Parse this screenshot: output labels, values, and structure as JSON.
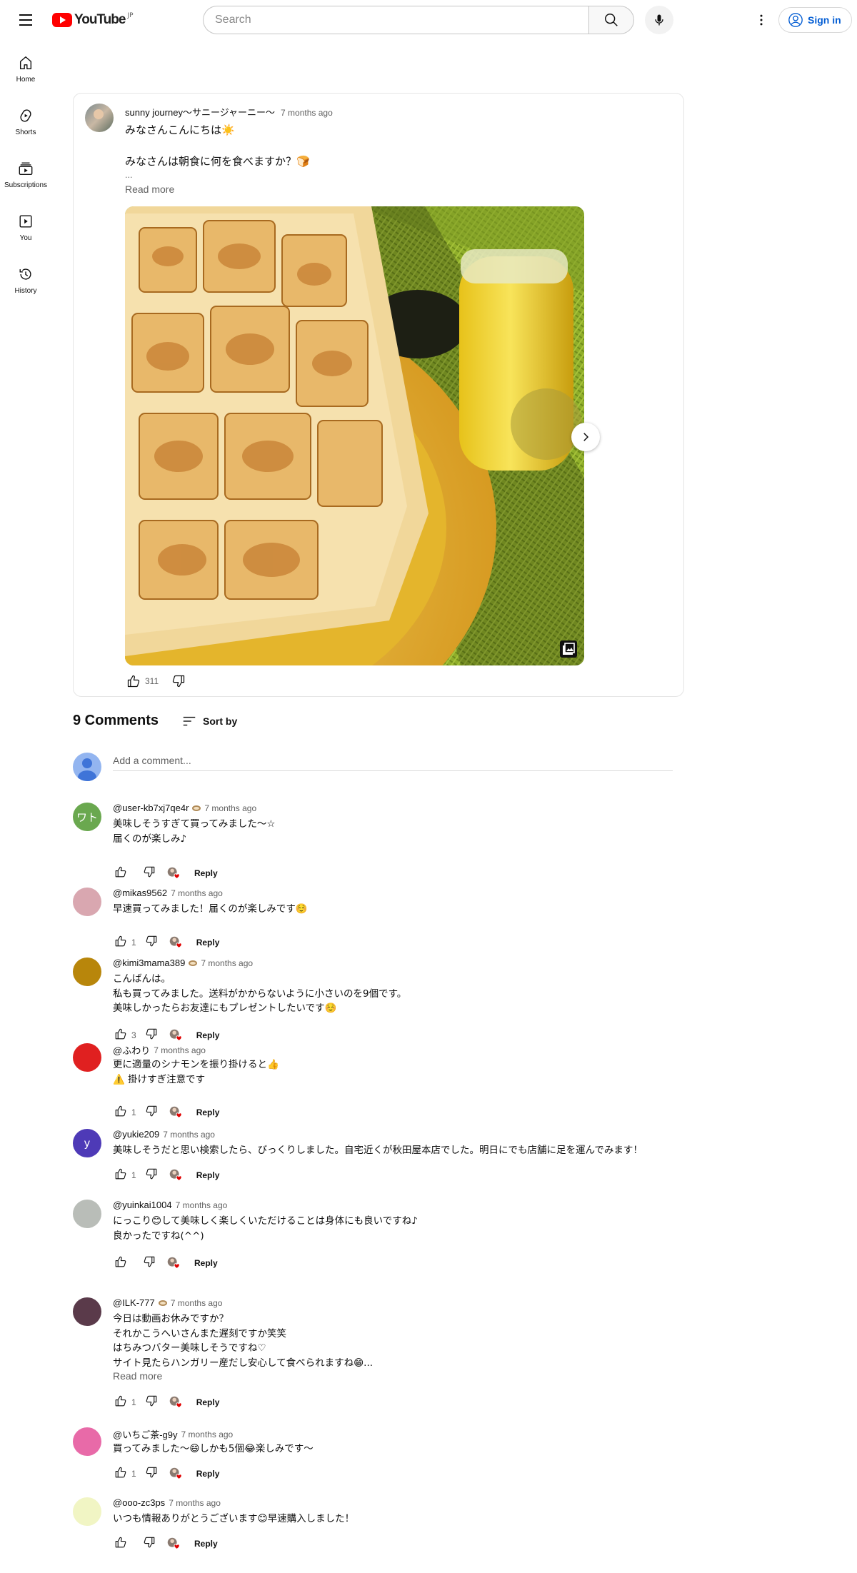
{
  "masthead": {
    "logo_text": "YouTube",
    "country_code": "JP",
    "search_placeholder": "Search",
    "signin_label": "Sign in"
  },
  "guide": {
    "items": [
      {
        "label": "Home",
        "icon": "home-icon"
      },
      {
        "label": "Shorts",
        "icon": "shorts-icon"
      },
      {
        "label": "Subscriptions",
        "icon": "subscriptions-icon"
      },
      {
        "label": "You",
        "icon": "you-icon"
      },
      {
        "label": "History",
        "icon": "history-icon"
      }
    ]
  },
  "post": {
    "author": "sunny journey〜サニージャーニー〜",
    "time": "7 months ago",
    "text": "みなさんこんにちは☀️\n\nみなさんは朝食に何を食べますか？🍞",
    "ellipsis": "...",
    "read_more": "Read more",
    "like_count": "311"
  },
  "comments_section": {
    "count_label": "9 Comments",
    "sort_label": "Sort by",
    "add_placeholder": "Add a comment..."
  },
  "comments": [
    {
      "author": "@user-kb7xj7qe4r",
      "badge": true,
      "time": "7 months ago",
      "text": "美味しそうすぎて買ってみました〜☆\n届くのが楽しみ♪",
      "likes": "",
      "avatar_text": "ワト",
      "avatar_color": "#6aa84f"
    },
    {
      "author": "@mikas9562",
      "badge": false,
      "time": "7 months ago",
      "text": "早速買ってみました！届くのが楽しみです☺️",
      "likes": "1",
      "avatar_text": "",
      "avatar_color": "#d9a7b0"
    },
    {
      "author": "@kimi3mama389",
      "badge": true,
      "time": "7 months ago",
      "text": "こんばんは。\n私も買ってみました。送料がかからないように小さいのを9個です。\n美味しかったらお友達にもプレゼントしたいです☺️",
      "likes": "3",
      "avatar_text": "",
      "avatar_color": "#b8860b"
    },
    {
      "author": "@ふわり",
      "badge": false,
      "time": "7 months ago",
      "text": "更に適量のシナモンを振り掛けると👍\n⚠️ 掛けすぎ注意です",
      "likes": "1",
      "avatar_text": "",
      "avatar_color": "#e02020"
    },
    {
      "author": "@yukie209",
      "badge": false,
      "time": "7 months ago",
      "text": "美味しそうだと思い検索したら、びっくりしました。自宅近くが秋田屋本店でした。明日にでも店舗に足を運んでみます！",
      "likes": "1",
      "avatar_text": "y",
      "avatar_color": "#4e3ab7"
    },
    {
      "author": "@yuinkai1004",
      "badge": false,
      "time": "7 months ago",
      "text": "にっこり😊して美味しく楽しくいただけることは身体にも良いですね♪\n良かったですね(^^)",
      "likes": "",
      "avatar_text": "",
      "avatar_color": "#b9bdb8"
    },
    {
      "author": "@ILK-777",
      "badge": true,
      "time": "7 months ago",
      "text": "今日は動画お休みですか？\nそれかこうへいさんまた遅刻ですか笑笑\nはちみつバター美味しそうですね♡\nサイト見たらハンガリー産だし安心して食べられますね😁...",
      "likes": "1",
      "read_more": "Read more",
      "avatar_text": "",
      "avatar_color": "#5a3a4a"
    },
    {
      "author": "@いちご茶-g9y",
      "badge": false,
      "time": "7 months ago",
      "text": "買ってみました〜😄しかも5個😂楽しみです〜",
      "likes": "1",
      "avatar_text": "",
      "avatar_color": "#e86aa8"
    },
    {
      "author": "@ooo-zc3ps",
      "badge": false,
      "time": "7 months ago",
      "text": "いつも情報ありがとうございます😊早速購入しました！",
      "likes": "",
      "avatar_text": "",
      "avatar_color": "#f1f5c4"
    }
  ],
  "colors": {
    "brand_red": "#ff0000",
    "signin_blue": "#065fd4",
    "secondary_text": "#606060"
  }
}
